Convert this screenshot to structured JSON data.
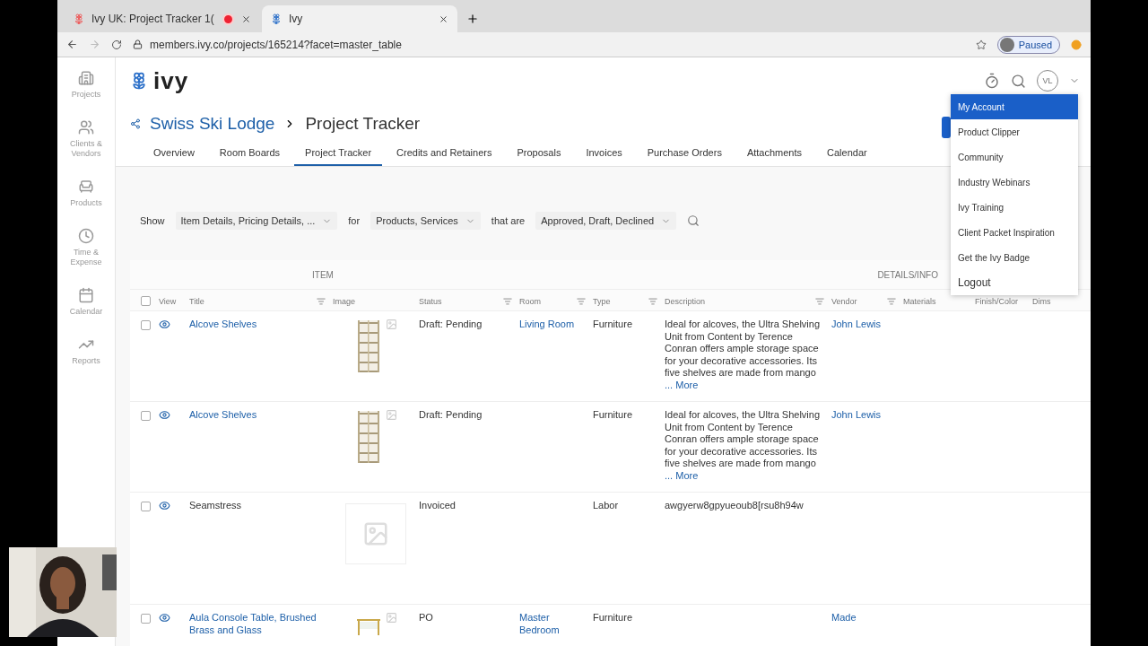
{
  "browser": {
    "tabs": [
      {
        "title": "Ivy UK: Project Tracker 1(",
        "recording": true,
        "selected": false
      },
      {
        "title": "Ivy",
        "recording": false,
        "selected": true
      }
    ],
    "url": "members.ivy.co/projects/165214?facet=master_table",
    "profile_label": "Paused"
  },
  "sidebar": {
    "items": [
      {
        "kind": "projects",
        "label": "Projects"
      },
      {
        "kind": "clients",
        "label": "Clients & Vendors"
      },
      {
        "kind": "products",
        "label": "Products"
      },
      {
        "kind": "time",
        "label": "Time & Expense"
      },
      {
        "kind": "calendar",
        "label": "Calendar"
      },
      {
        "kind": "reports",
        "label": "Reports"
      }
    ]
  },
  "logo": "ivy",
  "breadcrumb": {
    "project": "Swiss Ski Lodge",
    "page": "Project Tracker"
  },
  "avatar": "VL",
  "nav_tabs": [
    {
      "label": "Overview",
      "selected": false
    },
    {
      "label": "Room Boards",
      "selected": false
    },
    {
      "label": "Project Tracker",
      "selected": true
    },
    {
      "label": "Credits and Retainers",
      "selected": false
    },
    {
      "label": "Proposals",
      "selected": false
    },
    {
      "label": "Invoices",
      "selected": false
    },
    {
      "label": "Purchase Orders",
      "selected": false
    },
    {
      "label": "Attachments",
      "selected": false
    },
    {
      "label": "Calendar",
      "selected": false
    }
  ],
  "filters": [
    {
      "label": "Show",
      "value": "Item Details, Pricing Details, ..."
    },
    {
      "label": "for",
      "value": "Products, Services"
    },
    {
      "label": "that are",
      "value": "Approved, Draft, Declined"
    }
  ],
  "table": {
    "all_checked": false,
    "groups": [
      {
        "label": "ITEM"
      },
      {
        "label": "DETAILS/INFO"
      }
    ],
    "columns": [
      {
        "label": "View",
        "sortable": false
      },
      {
        "label": "Title",
        "sortable": true
      },
      {
        "label": "Image",
        "sortable": false
      },
      {
        "label": "Status",
        "sortable": true
      },
      {
        "label": "Room",
        "sortable": true
      },
      {
        "label": "Type",
        "sortable": true
      },
      {
        "label": "Description",
        "sortable": true
      },
      {
        "label": "Vendor",
        "sortable": true
      },
      {
        "label": "Materials",
        "sortable": false
      },
      {
        "label": "Finish/Color",
        "sortable": false
      },
      {
        "label": "Dims",
        "sortable": false
      }
    ],
    "rows": [
      {
        "checked": false,
        "title": "Alcove Shelves",
        "linked": true,
        "kind": "shelf",
        "status": "Draft: Pending",
        "room": "Living Room",
        "type": "Furniture",
        "description": "Ideal for alcoves, the Ultra Shelving Unit from Content by Terence Conran offers ample storage space for your decorative accessories. Its five shelves are made from mango",
        "more": "... More",
        "vendor": "John Lewis"
      },
      {
        "checked": false,
        "title": "Alcove Shelves",
        "linked": true,
        "kind": "shelf",
        "status": "Draft: Pending",
        "type": "Furniture",
        "description": "Ideal for alcoves, the Ultra Shelving Unit from Content by Terence Conran offers ample storage space for your decorative accessories. Its five shelves are made from mango",
        "more": "... More",
        "vendor": "John Lewis"
      },
      {
        "checked": false,
        "title": "Seamstress",
        "linked": false,
        "kind": "placeholder",
        "status": "Invoiced",
        "type": "Labor",
        "description": "awgyerw8gpyueoub8[rsu8h94w"
      },
      {
        "checked": false,
        "title": "Aula Console Table, Brushed Brass and Glass",
        "linked": true,
        "kind": "table",
        "status": "PO",
        "room": "Master Bedroom",
        "type": "Furniture",
        "vendor": "Made"
      }
    ]
  },
  "menu": {
    "items": [
      {
        "label": "My Account",
        "selected": true
      },
      {
        "label": "Product Clipper",
        "selected": false
      },
      {
        "label": "Community",
        "selected": false
      },
      {
        "label": "Industry Webinars",
        "selected": false
      },
      {
        "label": "Ivy Training",
        "selected": false
      },
      {
        "label": "Client Packet Inspiration",
        "selected": false
      },
      {
        "label": "Get the Ivy Badge",
        "selected": false
      },
      {
        "label": "Logout",
        "selected": false
      }
    ]
  }
}
